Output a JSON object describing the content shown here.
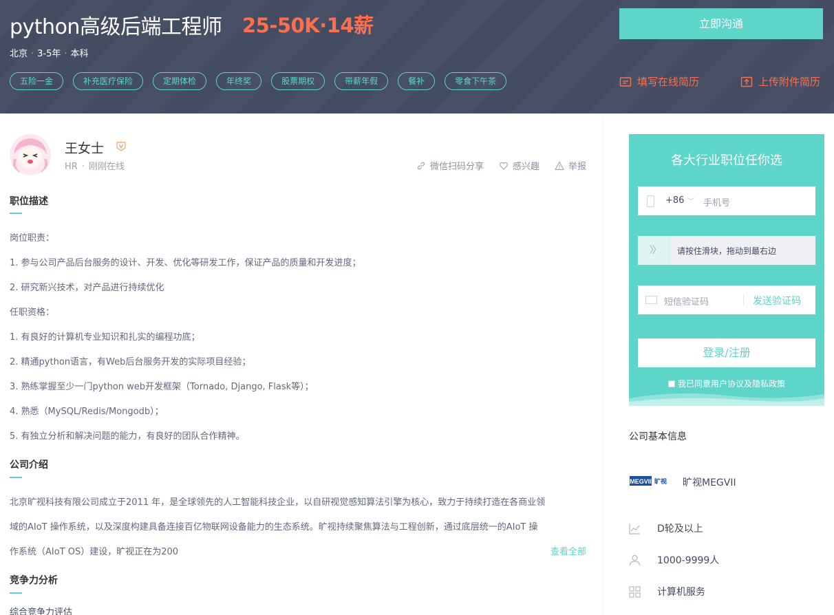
{
  "job": {
    "title": "python高级后端工程师",
    "salary": "25-50K·14薪",
    "city": "北京",
    "experience": "3-5年",
    "degree": "本科",
    "meta_dot": "·",
    "tags": [
      "五险一金",
      "补充医疗保险",
      "定期体检",
      "年终奖",
      "股票期权",
      "带薪年假",
      "餐补",
      "零食下午茶"
    ]
  },
  "actions": {
    "chat_now": "立即沟通",
    "fill_resume": "填写在线简历",
    "upload_resume": "上传附件简历"
  },
  "hr": {
    "name": "王女士",
    "role": "HR",
    "sep": "·",
    "status": "刚刚在线",
    "share": "微信扫码分享",
    "interest": "感兴趣",
    "report": "举报"
  },
  "description": {
    "title": "职位描述",
    "lines": [
      "岗位职责：",
      "1. 参与公司产品后台服务的设计、开发、优化等研发工作，保证产品的质量和开发进度；",
      "2. 研究新兴技术，对产品进行持续优化",
      "任职资格：",
      "1. 有良好的计算机专业知识和扎实的编程功底；",
      "2. 精通python语言，有Web后台服务开发的实际项目经验；",
      "3. 熟练掌握至少一门python web开发框架（Tornado, Django, Flask等）；",
      "4. 熟悉（MySQL/Redis/Mongodb）；",
      "5. 有独立分析和解决问题的能力，有良好的团队合作精神。"
    ]
  },
  "company_intro": {
    "title": "公司介绍",
    "lines": [
      "北京旷视科技有限公司成立于2011 年，是全球领先的人工智能科技企业，以自研视觉感知算法引擎为核心，致力于持续打造在各商业领",
      "域的AIoT 操作系统，以及深度构建具备连接百亿物联网设备能力的生态系统。旷视持续聚焦算法与工程创新，通过底层统一的AIoT 操",
      "作系统（AIoT OS）建设，旷视正在为200"
    ],
    "see_all": "查看全部"
  },
  "competition": {
    "title": "竞争力分析",
    "sub": "综合竞争力评估"
  },
  "login_card": {
    "title": "各大行业职位任你选",
    "country_code": "+86",
    "phone_placeholder": "手机号",
    "slider_text": "请按住滑块，拖动到最右边",
    "sms_placeholder": "短信验证码",
    "send_code": "发送验证码",
    "login_button": "登录/注册",
    "agreement": "我已同意用户协议及隐私政策"
  },
  "company": {
    "section_title": "公司基本信息",
    "logo_text": "MEGVII 旷视",
    "name": "旷视MEGVII",
    "stage": "D轮及以上",
    "size": "1000-9999人",
    "industry": "计算机服务"
  },
  "colors": {
    "header_bg": "#434c61",
    "accent": "#5dd5c8",
    "salary": "#fd6f4e"
  }
}
